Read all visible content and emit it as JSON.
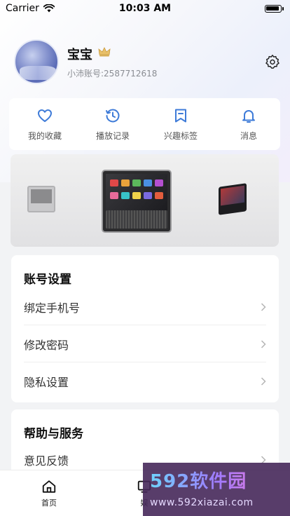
{
  "status_bar": {
    "carrier": "Carrier",
    "time": "10:03 AM",
    "battery_level": 1.0
  },
  "profile": {
    "name": "宝宝",
    "account_id": "小沛账号:2587712618"
  },
  "quick_actions": [
    {
      "label": "我的收藏",
      "icon": "heart-icon"
    },
    {
      "label": "播放记录",
      "icon": "history-icon"
    },
    {
      "label": "兴趣标签",
      "icon": "bookmark-icon"
    },
    {
      "label": "消息",
      "icon": "bell-icon"
    }
  ],
  "account_settings": {
    "title": "账号设置",
    "items": [
      "绑定手机号",
      "修改密码",
      "隐私设置"
    ]
  },
  "help_service": {
    "title": "帮助与服务",
    "items": [
      "意见反馈"
    ]
  },
  "tab_bar": {
    "tabs": [
      {
        "label": "首页",
        "icon": "home-icon"
      },
      {
        "label": "娱",
        "icon": "tv-icon"
      }
    ]
  },
  "watermark": {
    "title": "592软件园",
    "url": "www.592xiazai.com"
  },
  "colors": {
    "accent": "#3e7bd8",
    "crown": "#e8c06a"
  }
}
